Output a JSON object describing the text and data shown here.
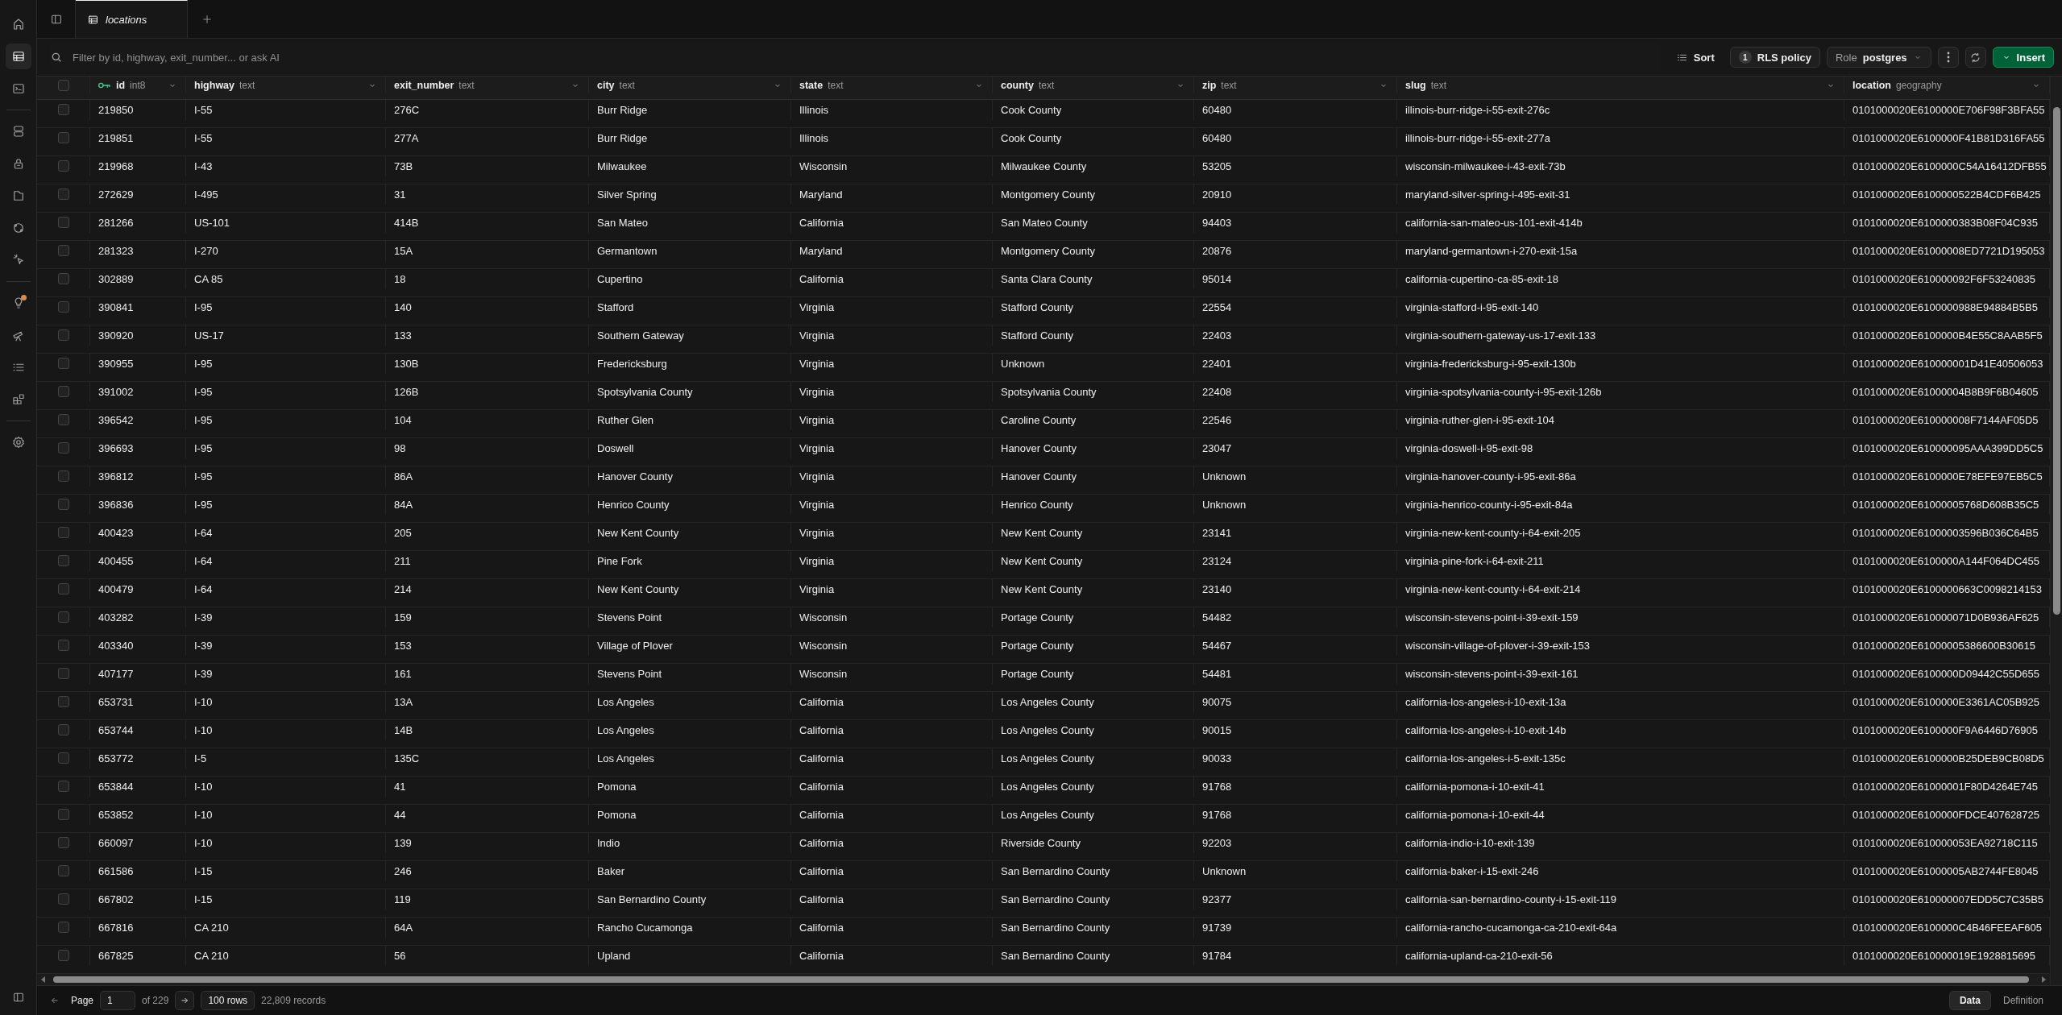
{
  "sidebar": {
    "groups": [
      [
        {
          "kind": "home",
          "selected": false,
          "badge": false
        },
        {
          "kind": "table",
          "selected": true,
          "badge": false
        },
        {
          "kind": "terminal",
          "selected": false,
          "badge": false
        }
      ],
      [
        {
          "kind": "database",
          "selected": false,
          "badge": false
        },
        {
          "kind": "lock",
          "selected": false,
          "badge": false
        },
        {
          "kind": "folder",
          "selected": false,
          "badge": false
        },
        {
          "kind": "realtime",
          "selected": false,
          "badge": false
        },
        {
          "kind": "pointer",
          "selected": false,
          "badge": false
        }
      ],
      [
        {
          "kind": "bulb",
          "selected": false,
          "badge": true
        },
        {
          "kind": "telescope",
          "selected": false,
          "badge": false
        },
        {
          "kind": "list",
          "selected": false,
          "badge": false
        },
        {
          "kind": "blocks",
          "selected": false,
          "badge": false
        }
      ],
      [
        {
          "kind": "gear",
          "selected": false,
          "badge": false
        }
      ]
    ]
  },
  "tabs": [
    {
      "label": "locations",
      "selected": true
    }
  ],
  "toolbar": {
    "filter": {
      "placeholder": "Filter by id, highway, exit_number... or ask AI"
    },
    "sort": "Sort",
    "rls": {
      "count": "1",
      "label": "RLS policy"
    },
    "role": {
      "label": "Role",
      "value": "postgres"
    },
    "insert": "Insert"
  },
  "table": {
    "select_all": {
      "checked": false
    },
    "columns": [
      {
        "name": "id",
        "type": "int8",
        "primary_key": true
      },
      {
        "name": "highway",
        "type": "text",
        "primary_key": false
      },
      {
        "name": "exit_number",
        "type": "text",
        "primary_key": false
      },
      {
        "name": "city",
        "type": "text",
        "primary_key": false
      },
      {
        "name": "state",
        "type": "text",
        "primary_key": false
      },
      {
        "name": "county",
        "type": "text",
        "primary_key": false
      },
      {
        "name": "zip",
        "type": "text",
        "primary_key": false
      },
      {
        "name": "slug",
        "type": "text",
        "primary_key": false
      },
      {
        "name": "location",
        "type": "geography",
        "primary_key": false
      }
    ],
    "rows": [
      {
        "checked": false,
        "cells": [
          "219850",
          "I-55",
          "276C",
          "Burr Ridge",
          "Illinois",
          "Cook County",
          "60480",
          "illinois-burr-ridge-i-55-exit-276c",
          "0101000020E6100000E706F98F3BFA55"
        ]
      },
      {
        "checked": false,
        "cells": [
          "219851",
          "I-55",
          "277A",
          "Burr Ridge",
          "Illinois",
          "Cook County",
          "60480",
          "illinois-burr-ridge-i-55-exit-277a",
          "0101000020E6100000F41B81D316FA55"
        ]
      },
      {
        "checked": false,
        "cells": [
          "219968",
          "I-43",
          "73B",
          "Milwaukee",
          "Wisconsin",
          "Milwaukee County",
          "53205",
          "wisconsin-milwaukee-i-43-exit-73b",
          "0101000020E6100000C54A16412DFB55"
        ]
      },
      {
        "checked": false,
        "cells": [
          "272629",
          "I-495",
          "31",
          "Silver Spring",
          "Maryland",
          "Montgomery County",
          "20910",
          "maryland-silver-spring-i-495-exit-31",
          "0101000020E6100000522B4CDF6B425"
        ]
      },
      {
        "checked": false,
        "cells": [
          "281266",
          "US-101",
          "414B",
          "San Mateo",
          "California",
          "San Mateo County",
          "94403",
          "california-san-mateo-us-101-exit-414b",
          "0101000020E6100000383B08F04C935"
        ]
      },
      {
        "checked": false,
        "cells": [
          "281323",
          "I-270",
          "15A",
          "Germantown",
          "Maryland",
          "Montgomery County",
          "20876",
          "maryland-germantown-i-270-exit-15a",
          "0101000020E61000008ED7721D195053"
        ]
      },
      {
        "checked": false,
        "cells": [
          "302889",
          "CA 85",
          "18",
          "Cupertino",
          "California",
          "Santa Clara County",
          "95014",
          "california-cupertino-ca-85-exit-18",
          "0101000020E610000092F6F53240835"
        ]
      },
      {
        "checked": false,
        "cells": [
          "390841",
          "I-95",
          "140",
          "Stafford",
          "Virginia",
          "Stafford County",
          "22554",
          "virginia-stafford-i-95-exit-140",
          "0101000020E6100000988E94884B5B5"
        ]
      },
      {
        "checked": false,
        "cells": [
          "390920",
          "US-17",
          "133",
          "Southern Gateway",
          "Virginia",
          "Stafford County",
          "22403",
          "virginia-southern-gateway-us-17-exit-133",
          "0101000020E6100000B4E55C8AAB5F5"
        ]
      },
      {
        "checked": false,
        "cells": [
          "390955",
          "I-95",
          "130B",
          "Fredericksburg",
          "Virginia",
          "Unknown",
          "22401",
          "virginia-fredericksburg-i-95-exit-130b",
          "0101000020E610000001D41E40506053"
        ]
      },
      {
        "checked": false,
        "cells": [
          "391002",
          "I-95",
          "126B",
          "Spotsylvania County",
          "Virginia",
          "Spotsylvania County",
          "22408",
          "virginia-spotsylvania-county-i-95-exit-126b",
          "0101000020E61000004B8B9F6B04605"
        ]
      },
      {
        "checked": false,
        "cells": [
          "396542",
          "I-95",
          "104",
          "Ruther Glen",
          "Virginia",
          "Caroline County",
          "22546",
          "virginia-ruther-glen-i-95-exit-104",
          "0101000020E610000008F7144AF05D5"
        ]
      },
      {
        "checked": false,
        "cells": [
          "396693",
          "I-95",
          "98",
          "Doswell",
          "Virginia",
          "Hanover County",
          "23047",
          "virginia-doswell-i-95-exit-98",
          "0101000020E610000095AAA399DD5C5"
        ]
      },
      {
        "checked": false,
        "cells": [
          "396812",
          "I-95",
          "86A",
          "Hanover County",
          "Virginia",
          "Hanover County",
          "Unknown",
          "virginia-hanover-county-i-95-exit-86a",
          "0101000020E6100000E78EFE97EB5C5"
        ]
      },
      {
        "checked": false,
        "cells": [
          "396836",
          "I-95",
          "84A",
          "Henrico County",
          "Virginia",
          "Henrico County",
          "Unknown",
          "virginia-henrico-county-i-95-exit-84a",
          "0101000020E61000005768D608B35C5"
        ]
      },
      {
        "checked": false,
        "cells": [
          "400423",
          "I-64",
          "205",
          "New Kent County",
          "Virginia",
          "New Kent County",
          "23141",
          "virginia-new-kent-county-i-64-exit-205",
          "0101000020E61000003596B036C64B5"
        ]
      },
      {
        "checked": false,
        "cells": [
          "400455",
          "I-64",
          "211",
          "Pine Fork",
          "Virginia",
          "New Kent County",
          "23124",
          "virginia-pine-fork-i-64-exit-211",
          "0101000020E6100000A144F064DC455"
        ]
      },
      {
        "checked": false,
        "cells": [
          "400479",
          "I-64",
          "214",
          "New Kent County",
          "Virginia",
          "New Kent County",
          "23140",
          "virginia-new-kent-county-i-64-exit-214",
          "0101000020E6100000663C0098214153"
        ]
      },
      {
        "checked": false,
        "cells": [
          "403282",
          "I-39",
          "159",
          "Stevens Point",
          "Wisconsin",
          "Portage County",
          "54482",
          "wisconsin-stevens-point-i-39-exit-159",
          "0101000020E610000071D0B936AF625"
        ]
      },
      {
        "checked": false,
        "cells": [
          "403340",
          "I-39",
          "153",
          "Village of Plover",
          "Wisconsin",
          "Portage County",
          "54467",
          "wisconsin-village-of-plover-i-39-exit-153",
          "0101000020E61000005386600B30615"
        ]
      },
      {
        "checked": false,
        "cells": [
          "407177",
          "I-39",
          "161",
          "Stevens Point",
          "Wisconsin",
          "Portage County",
          "54481",
          "wisconsin-stevens-point-i-39-exit-161",
          "0101000020E6100000D09442C55D655"
        ]
      },
      {
        "checked": false,
        "cells": [
          "653731",
          "I-10",
          "13A",
          "Los Angeles",
          "California",
          "Los Angeles County",
          "90075",
          "california-los-angeles-i-10-exit-13a",
          "0101000020E6100000E3361AC05B925"
        ]
      },
      {
        "checked": false,
        "cells": [
          "653744",
          "I-10",
          "14B",
          "Los Angeles",
          "California",
          "Los Angeles County",
          "90015",
          "california-los-angeles-i-10-exit-14b",
          "0101000020E6100000F9A6446D76905"
        ]
      },
      {
        "checked": false,
        "cells": [
          "653772",
          "I-5",
          "135C",
          "Los Angeles",
          "California",
          "Los Angeles County",
          "90033",
          "california-los-angeles-i-5-exit-135c",
          "0101000020E6100000B25DEB9CB08D5"
        ]
      },
      {
        "checked": false,
        "cells": [
          "653844",
          "I-10",
          "41",
          "Pomona",
          "California",
          "Los Angeles County",
          "91768",
          "california-pomona-i-10-exit-41",
          "0101000020E61000001F80D4264E745"
        ]
      },
      {
        "checked": false,
        "cells": [
          "653852",
          "I-10",
          "44",
          "Pomona",
          "California",
          "Los Angeles County",
          "91768",
          "california-pomona-i-10-exit-44",
          "0101000020E6100000FDCE407628725"
        ]
      },
      {
        "checked": false,
        "cells": [
          "660097",
          "I-10",
          "139",
          "Indio",
          "California",
          "Riverside County",
          "92203",
          "california-indio-i-10-exit-139",
          "0101000020E610000053EA92718C115"
        ]
      },
      {
        "checked": false,
        "cells": [
          "661586",
          "I-15",
          "246",
          "Baker",
          "California",
          "San Bernardino County",
          "Unknown",
          "california-baker-i-15-exit-246",
          "0101000020E61000005AB2744FE8045"
        ]
      },
      {
        "checked": false,
        "cells": [
          "667802",
          "I-15",
          "119",
          "San Bernardino County",
          "California",
          "San Bernardino County",
          "92377",
          "california-san-bernardino-county-i-15-exit-119",
          "0101000020E610000007EDD5C7C35B5"
        ]
      },
      {
        "checked": false,
        "cells": [
          "667816",
          "CA 210",
          "64A",
          "Rancho Cucamonga",
          "California",
          "San Bernardino County",
          "91739",
          "california-rancho-cucamonga-ca-210-exit-64a",
          "0101000020E6100000C4B46FEEAF605"
        ]
      },
      {
        "checked": false,
        "cells": [
          "667825",
          "CA 210",
          "56",
          "Upland",
          "California",
          "San Bernardino County",
          "91784",
          "california-upland-ca-210-exit-56",
          "0101000020E610000019E1928815695"
        ]
      }
    ]
  },
  "footer": {
    "page_label": "Page",
    "page": "1",
    "page_total": "of 229",
    "page_size": "100 rows",
    "records": "22,809 records",
    "views": [
      {
        "label": "Data",
        "selected": true
      },
      {
        "label": "Definition",
        "selected": false
      }
    ]
  }
}
